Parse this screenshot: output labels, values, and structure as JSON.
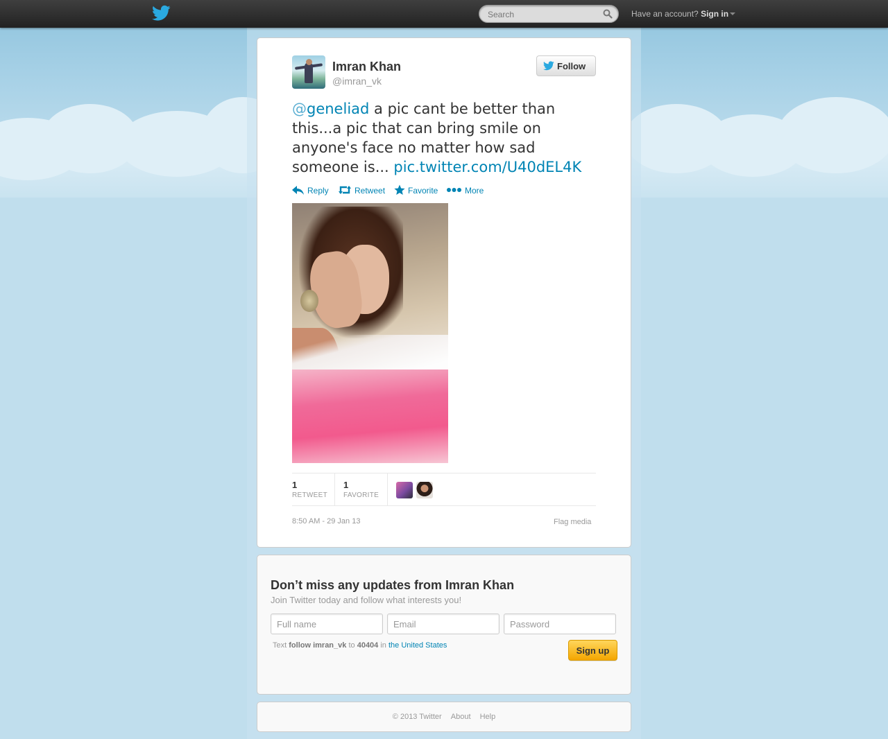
{
  "topbar": {
    "search_placeholder": "Search",
    "account_prompt": "Have an account?",
    "sign_in_label": "Sign in"
  },
  "tweet": {
    "author_name": "Imran Khan",
    "author_handle": "@imran_vk",
    "follow_label": "Follow",
    "mention_at": "@",
    "mention_name": "geneliad",
    "text_body": " a pic cant be better than this...a pic that can bring smile on anyone's face no matter how sad someone is... ",
    "link_text": "pic.twitter.com/U40dEL4K",
    "actions": {
      "reply": "Reply",
      "retweet": "Retweet",
      "favorite": "Favorite",
      "more": "More"
    },
    "stats": {
      "retweet_count": "1",
      "retweet_label": "RETWEET",
      "favorite_count": "1",
      "favorite_label": "FAVORITE"
    },
    "timestamp": "8:50 AM - 29 Jan 13",
    "flag_label": "Flag media"
  },
  "signup": {
    "title": "Don’t miss any updates from Imran Khan",
    "subtitle": "Join Twitter today and follow what interests you!",
    "fullname_placeholder": "Full name",
    "email_placeholder": "Email",
    "password_placeholder": "Password",
    "sms_text": "Text",
    "sms_command": "follow imran_vk",
    "sms_to": "to",
    "sms_number": "40404",
    "sms_in": "in",
    "sms_country": "the United States",
    "signup_label": "Sign up"
  },
  "footer": {
    "copyright": "© 2013 Twitter",
    "about": "About",
    "help": "Help"
  },
  "colors": {
    "link": "#0084b4",
    "twitter_blue": "#2aa9e0",
    "signup_yellow": "#f4a600",
    "background": "#c0deed"
  }
}
